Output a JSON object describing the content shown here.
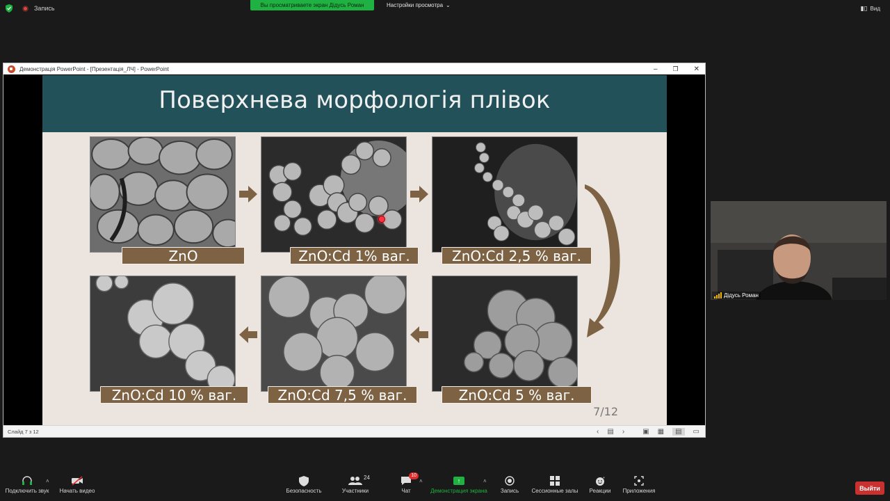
{
  "topbar": {
    "recording_label": "Запись",
    "viewing_banner": "Вы просматриваете экран Дідусь Роман",
    "view_settings_label": "Настройки просмотра",
    "view_button_label": "Вид"
  },
  "ppt_window": {
    "title": "Демонстрація PowerPoint - [Презентація_ЛЧ] - PowerPoint",
    "status": "Слайд 7 з 12"
  },
  "slide": {
    "title": "Поверхнева морфологія плівок",
    "page": "7/12",
    "images": [
      {
        "label": "ZnO"
      },
      {
        "label": "ZnO:Cd 1% ваг."
      },
      {
        "label": "ZnO:Cd 2,5 % ваг."
      },
      {
        "label": "ZnO:Cd 5 % ваг."
      },
      {
        "label": "ZnO:Cd 7,5 % ваг."
      },
      {
        "label": "ZnO:Cd 10 % ваг."
      }
    ],
    "colors": {
      "header": "#23515a",
      "background": "#ece5df",
      "label": "#7d6344",
      "arrow": "#7d6344"
    }
  },
  "webcam": {
    "name": "Дідусь Роман"
  },
  "toolbar": {
    "audio": "Подключить звук",
    "video": "Начать видео",
    "security": "Безопасность",
    "participants": "Участники",
    "participants_count": "24",
    "chat": "Чат",
    "chat_badge": "10",
    "share": "Демонстрация экрана",
    "record": "Запись",
    "rooms": "Сессионные залы",
    "reactions": "Реакции",
    "apps": "Приложения",
    "leave": "Выйти"
  }
}
